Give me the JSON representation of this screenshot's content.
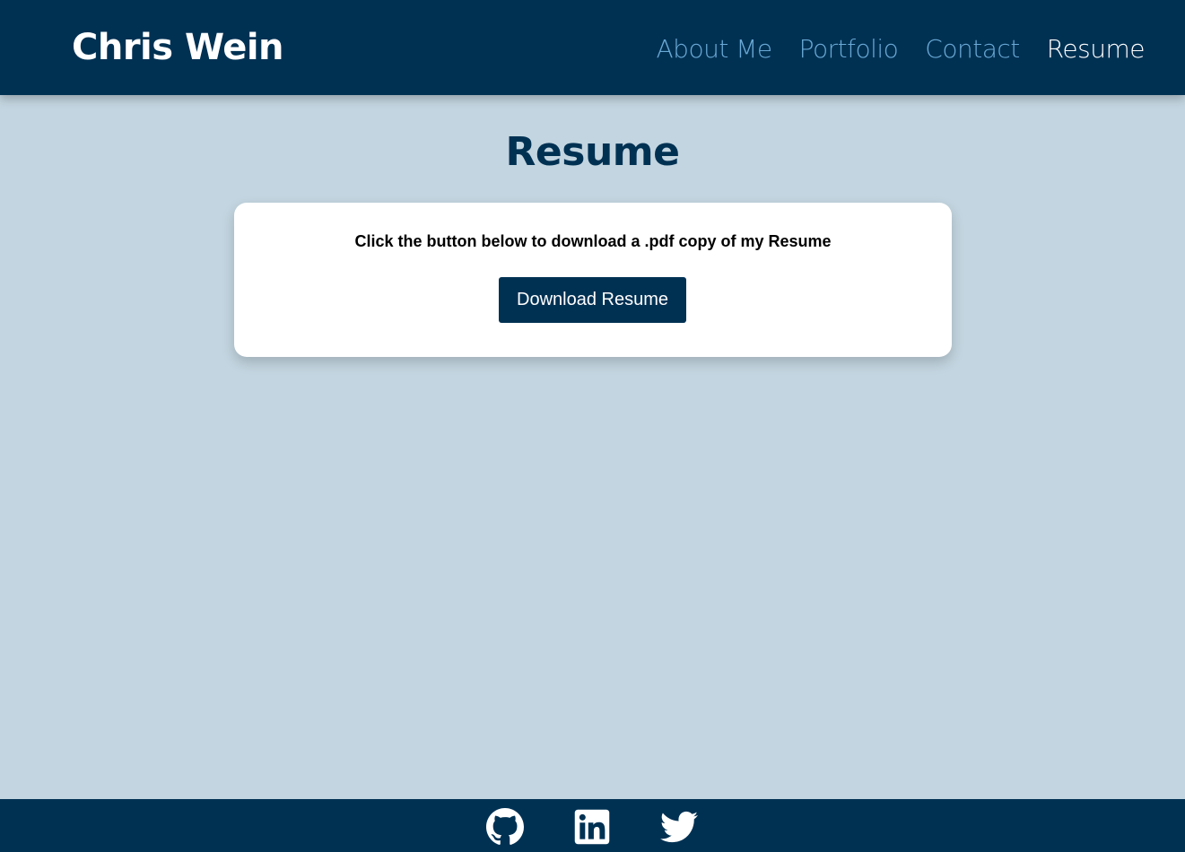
{
  "header": {
    "brand": "Chris Wein",
    "nav": [
      {
        "label": "About Me",
        "active": false
      },
      {
        "label": "Portfolio",
        "active": false
      },
      {
        "label": "Contact",
        "active": false
      },
      {
        "label": "Resume",
        "active": true
      }
    ]
  },
  "main": {
    "title": "Resume",
    "card_text": "Click the button below to download a .pdf copy of my Resume",
    "download_label": "Download Resume"
  },
  "footer": {
    "icons": [
      "github-icon",
      "linkedin-icon",
      "twitter-icon"
    ]
  },
  "colors": {
    "primary": "#003153",
    "background": "#c3d5e0",
    "nav_link": "#6aa9d6",
    "card": "#ffffff"
  }
}
